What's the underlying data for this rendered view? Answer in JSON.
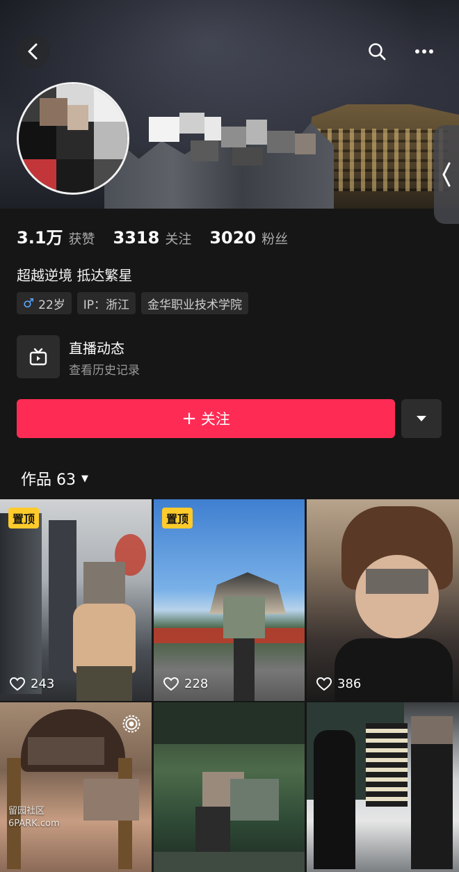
{
  "profile": {
    "stats": [
      {
        "value": "3.1万",
        "label": "获赞"
      },
      {
        "value": "3318",
        "label": "关注"
      },
      {
        "value": "3020",
        "label": "粉丝"
      }
    ],
    "bio": "超越逆境 抵达繁星",
    "tags": {
      "gender_symbol": "♂",
      "age": "22岁",
      "ip": "IP：浙江",
      "school": "金华职业技术学院"
    }
  },
  "live": {
    "title": "直播动态",
    "subtitle": "查看历史记录"
  },
  "actions": {
    "follow_plus": "+",
    "follow_label": "关注"
  },
  "works": {
    "label": "作品 63",
    "caret": "▼"
  },
  "videos": [
    {
      "pinned": "置顶",
      "likes": "243"
    },
    {
      "pinned": "置顶",
      "likes": "228"
    },
    {
      "likes": "386"
    },
    {},
    {},
    {}
  ],
  "watermark": {
    "line1": "留园社区",
    "line2": "6PARK.com"
  },
  "icons": {
    "back": "chevron-left",
    "search": "search",
    "more": "ellipsis",
    "side": "chevron-left",
    "live": "tv",
    "dropdown": "triangle-down",
    "like": "heart",
    "live_badge": "broadcast"
  }
}
